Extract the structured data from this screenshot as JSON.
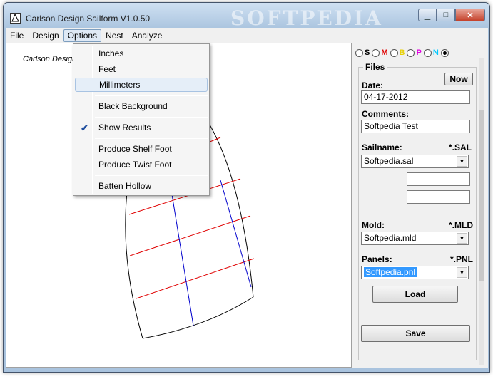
{
  "window": {
    "title": "Carlson Design Sailform V1.0.50",
    "watermark": "SOFTPEDIA",
    "controls": {
      "minimize": "▁",
      "maximize": "□",
      "close": "✕"
    }
  },
  "menubar": {
    "items": [
      {
        "label": "File"
      },
      {
        "label": "Design"
      },
      {
        "label": "Options"
      },
      {
        "label": "Nest"
      },
      {
        "label": "Analyze"
      }
    ]
  },
  "options_menu": {
    "items": [
      {
        "label": "Inches"
      },
      {
        "label": "Feet"
      },
      {
        "label": "Millimeters"
      },
      {
        "label": "Black Background"
      },
      {
        "label": "Show Results",
        "checked": true
      },
      {
        "label": "Produce Shelf Foot"
      },
      {
        "label": "Produce Twist Foot"
      },
      {
        "label": "Batten Hollow"
      }
    ]
  },
  "canvas": {
    "label": "Carlson Design",
    "colors": {
      "outline": "#000000",
      "seams": "#e00000",
      "batten": "#0000cc"
    }
  },
  "view_selector": {
    "options": [
      {
        "letter": "S",
        "color": "#000000"
      },
      {
        "letter": "M",
        "color": "#e00000"
      },
      {
        "letter": "B",
        "color": "#e8d000"
      },
      {
        "letter": "P",
        "color": "#e000e0"
      },
      {
        "letter": "N",
        "color": "#00c8ff"
      },
      {
        "letter": "",
        "color": "#000000",
        "checked": true
      }
    ]
  },
  "files_panel": {
    "group_title": "Files",
    "now_button": "Now",
    "date_label": "Date:",
    "date_value": "04-17-2012",
    "comments_label": "Comments:",
    "comments_value": "Softpedia Test",
    "sailname_label": "Sailname:",
    "sailname_ext": "*.SAL",
    "sailname_value": "Softpedia.sal",
    "extra_field_1": "",
    "extra_field_2": "",
    "mold_label": "Mold:",
    "mold_ext": "*.MLD",
    "mold_value": "Softpedia.mld",
    "panels_label": "Panels:",
    "panels_ext": "*.PNL",
    "panels_value": "Softpedia.pnl",
    "load_button": "Load",
    "save_button": "Save"
  }
}
